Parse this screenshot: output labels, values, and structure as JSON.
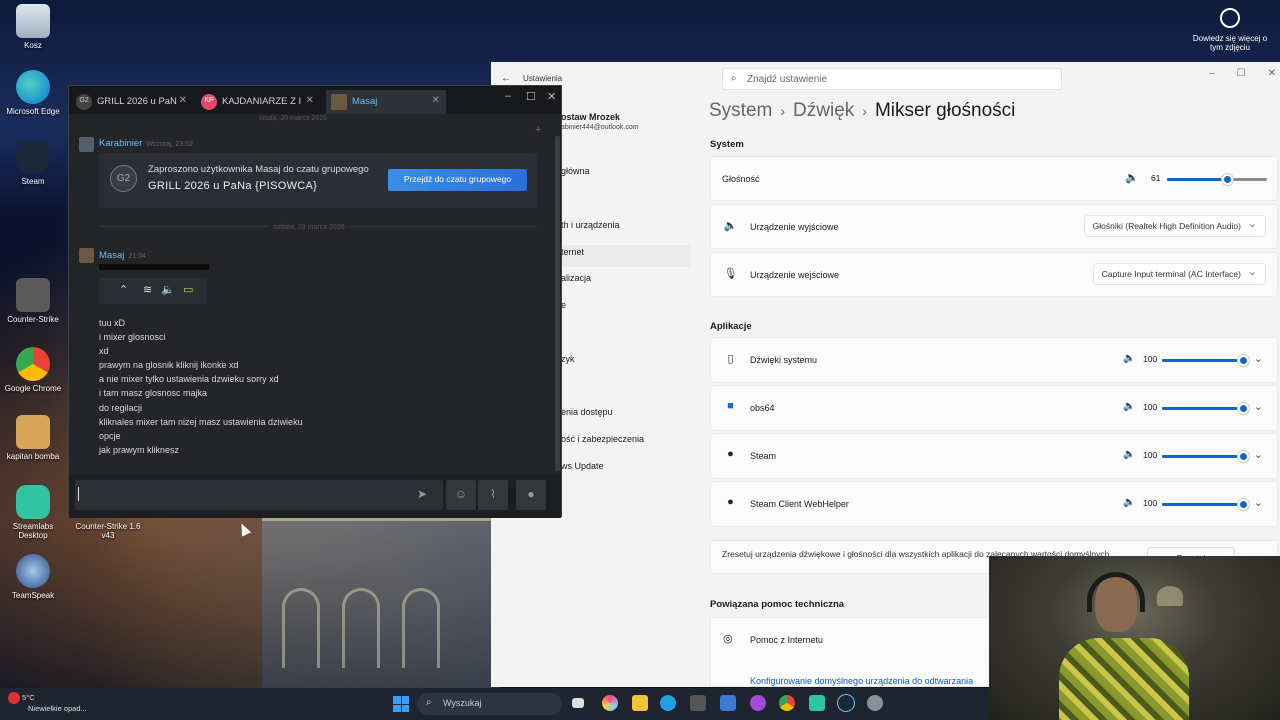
{
  "desktop": {
    "icons": [
      {
        "label": "Kosz"
      },
      {
        "label": "Microsoft Edge"
      },
      {
        "label": "Steam"
      },
      {
        "label": "Counter-Strike"
      },
      {
        "label": "Google Chrome"
      },
      {
        "label": "kapitan bomba"
      },
      {
        "label": "Streamlabs Desktop"
      },
      {
        "label": "Counter-Strike 1.6 v43"
      },
      {
        "label": "TeamSpeak"
      }
    ],
    "learn_more": "Dowiedz się więcej o tym zdjęciu"
  },
  "chat": {
    "tabs": [
      {
        "icon": "G2",
        "label": "GRILL 2026 u PaN"
      },
      {
        "icon": "KP",
        "label": "KAJDANIARZE Z I"
      },
      {
        "icon": "",
        "label": "Masaj"
      }
    ],
    "date_top": "środa, 20 marca 2026",
    "msg1": {
      "author": "Karabinier",
      "time": "Wczoraj, 23:02"
    },
    "invite": {
      "badge": "G2",
      "text": "Zaproszono użytkownika Masaj do czatu grupowego",
      "group": "GRILL 2026 u PaNa {PISOWCA}",
      "button": "Przejdź do czatu grupowego"
    },
    "date_sep": "sobota, 28 marca 2026",
    "msg2": {
      "author": "Masaj",
      "time": "21:04"
    },
    "lines": [
      "tuu xD",
      "i mixer glosnosci",
      "xd",
      "prawym na glosnik kliknij ikonke xd",
      "a nie mixer tylko ustawienia dzwieku sorry xd",
      "i tam masz glosnosc majka",
      "do regilacji",
      "kliknales mixer tam nizej masz ustawienia dziwieku",
      "opcje",
      "jak prawym kliknesz"
    ]
  },
  "settings": {
    "app_title": "Ustawienia",
    "search_placeholder": "Znajdź ustawienie",
    "profile": {
      "name": "ostaw Mrozek",
      "email": "abinier444@outlook.com"
    },
    "sidebar": [
      "główna",
      "th i urządzenia",
      "ternet",
      "alizacja",
      "e",
      "zyk",
      "enia dostępu",
      "ość i zabezpieczenia",
      "ws Update"
    ],
    "breadcrumb": {
      "a": "System",
      "b": "Dźwięk",
      "c": "Mikser głośności"
    },
    "system_title": "System",
    "volume_label": "Głośność",
    "volume_value": "61",
    "output_label": "Urządzenie wyjściowe",
    "output_value": "Głośniki (Realtek High Definition Audio)",
    "input_label": "Urządzenie wejściowe",
    "input_value": "Capture Input terminal (AC Interface)",
    "apps_title": "Aplikacje",
    "apps": [
      {
        "name": "Dźwięki systemu",
        "value": "100"
      },
      {
        "name": "obs64",
        "value": "100"
      },
      {
        "name": "Steam",
        "value": "100"
      },
      {
        "name": "Steam Client WebHelper",
        "value": "100"
      }
    ],
    "reset_text": "Zresetuj urządzenia dźwiękowe i głośności dla wszystkich aplikacji do zalecanych wartości domyślnych",
    "reset_button": "Resetuj",
    "help_title": "Powiązana pomoc techniczna",
    "help_item": "Pomoc z Internetu",
    "help_link": "Konfigurowanie domyślnego urządzenia do odtwarzania"
  },
  "taskbar": {
    "temp": "5°C",
    "weather": "Niewielkie opad...",
    "search": "Wyszukaj"
  },
  "colors": {
    "accent": "#1864c0",
    "steam_blue": "#66c0f4"
  }
}
